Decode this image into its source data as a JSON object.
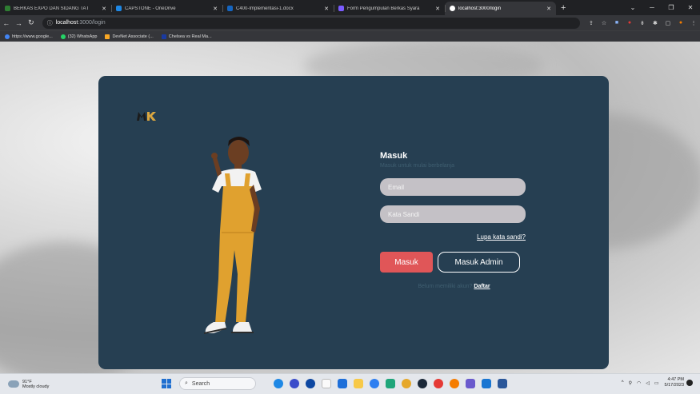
{
  "browser": {
    "tabs": [
      {
        "title": "BERKAS EXPO DAN SIDANG TA I",
        "color": "#2e7d32",
        "active": false
      },
      {
        "title": "CAPSTONE - OneDrive",
        "color": "#1e88e5",
        "active": false
      },
      {
        "title": "C400-Implementasi-1.docx",
        "color": "#1565c0",
        "active": false
      },
      {
        "title": "Form Pengumpulan Berkas Syara",
        "color": "#7b5cff",
        "active": false
      },
      {
        "title": "localhost:3000/login",
        "color": "#ffffff",
        "active": true
      }
    ],
    "new_tab_label": "+",
    "address": {
      "host": "localhost",
      "path": ":3000/login"
    },
    "bookmarks": [
      {
        "label": "https://www.google...",
        "color": "#4285f4"
      },
      {
        "label": "(32) WhatsApp",
        "color": "#25d366"
      },
      {
        "label": "DevNet Associate (...",
        "color": "#f9a825"
      },
      {
        "label": "Chelsea vs Real Ma...",
        "color": "#1a3aa0"
      }
    ]
  },
  "login": {
    "logo_text": "MK",
    "title": "Masuk",
    "subtitle": "Masuk untuk mulai berbelanja",
    "email_placeholder": "Email",
    "password_placeholder": "Kata Sandi",
    "forgot_label": "Lupa kata sandi?",
    "login_button": "Masuk",
    "admin_button": "Masuk Admin",
    "register_prompt": "Belum memiliki akun?",
    "register_link": "Daftar",
    "colors": {
      "card": "#263f52",
      "primary": "#e05658",
      "input": "#c4c1c6"
    }
  },
  "taskbar": {
    "weather_temp": "91°F",
    "weather_desc": "Mostly cloudy",
    "search_label": "Search",
    "time": "4:47 PM",
    "date": "5/17/2023"
  }
}
